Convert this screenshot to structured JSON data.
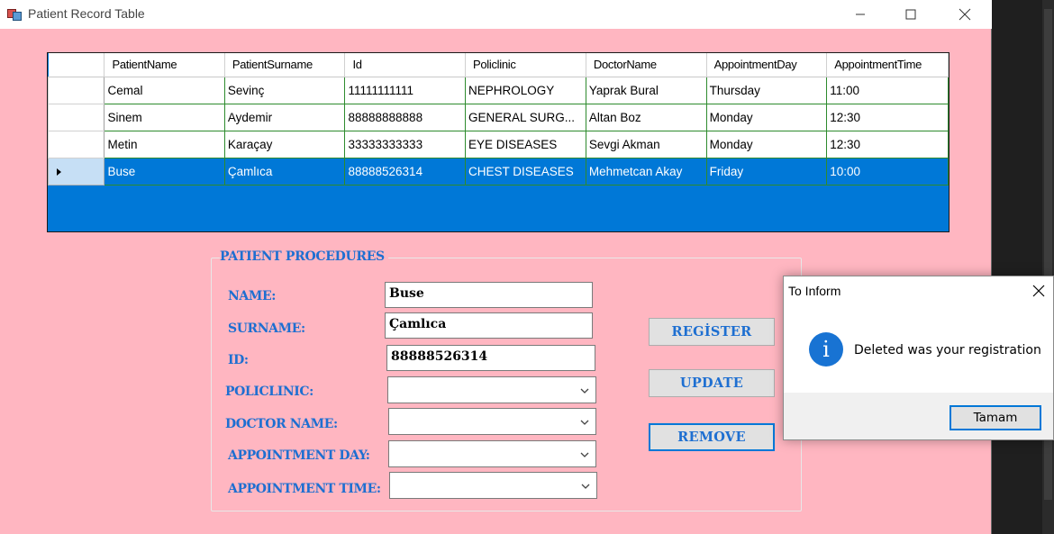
{
  "window": {
    "title": "Patient Record Table",
    "minimize_icon": "minimize-icon",
    "maximize_icon": "maximize-icon",
    "close_icon": "close-icon"
  },
  "grid": {
    "columns": [
      "PatientName",
      "PatientSurname",
      "Id",
      "Policlinic",
      "DoctorName",
      "AppointmentDay",
      "AppointmentTime"
    ],
    "rows": [
      [
        "Cemal",
        "Sevinç",
        "11111111111",
        "NEPHROLOGY",
        "Yaprak Bural",
        "Thursday",
        "11:00"
      ],
      [
        "Sinem",
        "Aydemir",
        "88888888888",
        "GENERAL SURG...",
        "Altan Boz",
        "Monday",
        "12:30"
      ],
      [
        "Metin",
        "Karaçay",
        "33333333333",
        "EYE DISEASES",
        "Sevgi Akman",
        "Monday",
        "12:30"
      ],
      [
        "Buse",
        "Çamlıca",
        "88888526314",
        "CHEST DISEASES",
        "Mehmetcan Akay",
        "Friday",
        "10:00"
      ]
    ],
    "selected_row": 3,
    "colors": {
      "selection": "#0078d7",
      "cell_border": "#2e8b2e",
      "background": "#0078d7"
    }
  },
  "form": {
    "group_title": "PATIENT PROCEDURES",
    "labels": {
      "name": "NAME:",
      "surname": "SURNAME:",
      "id": "ID:",
      "policlinic": "POLICLINIC:",
      "doctor_name": "DOCTOR NAME:",
      "appointment_day": "APPOINTMENT DAY:",
      "appointment_time": "APPOINTMENT TIME:"
    },
    "values": {
      "name": "Buse",
      "surname": "Çamlıca",
      "id": "88888526314",
      "policlinic": "",
      "doctor_name": "",
      "appointment_day": "",
      "appointment_time": ""
    },
    "buttons": {
      "register": "REGİSTER",
      "update": "UPDATE",
      "remove": "REMOVE"
    },
    "colors": {
      "label": "#1e6fd1",
      "background": "#ffb6c1"
    }
  },
  "dialog": {
    "title": "To Inform",
    "message": "Deleted was your registration",
    "ok_label": "Tamam",
    "icon": "info-icon",
    "icon_glyph": "i",
    "colors": {
      "icon": "#1873d3",
      "footer": "#f0f0f0"
    }
  }
}
